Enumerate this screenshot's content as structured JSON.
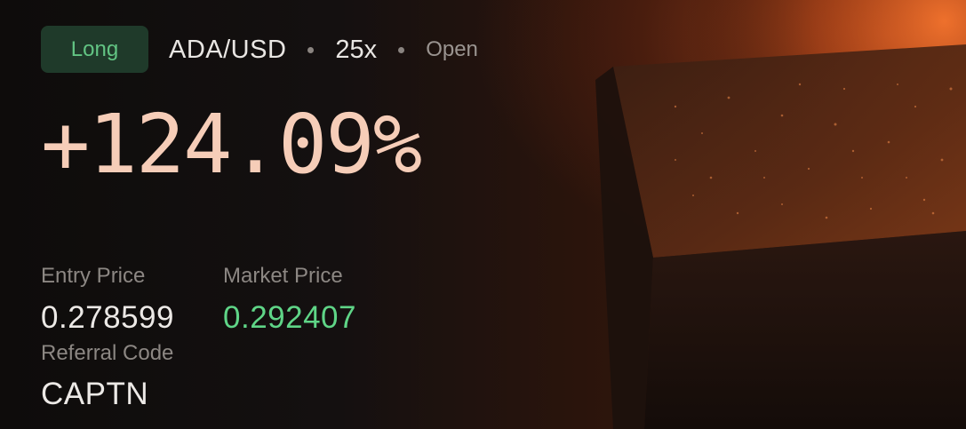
{
  "position": {
    "side": "Long",
    "pair": "ADA/USD",
    "leverage": "25x",
    "status": "Open"
  },
  "pnl_percent": "+124.09%",
  "stats": {
    "entry_price_label": "Entry Price",
    "entry_price": "0.278599",
    "market_price_label": "Market Price",
    "market_price": "0.292407",
    "referral_label": "Referral Code",
    "referral_code": "CAPTN"
  },
  "colors": {
    "long_badge_bg": "#1f3a2a",
    "long_badge_text": "#62c483",
    "pnl": "#f6cdb8",
    "market_price": "#5fd587",
    "accent_glow": "#e15a23"
  },
  "icons": [
    "separator-dot-icon"
  ]
}
